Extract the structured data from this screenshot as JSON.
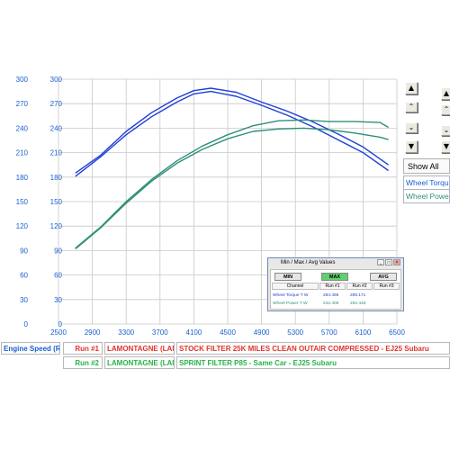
{
  "window": {
    "show_all_label": "Show All",
    "scroll_buttons": [
      "up-double",
      "up",
      "down",
      "down-double"
    ]
  },
  "axes": {
    "left_outer_ticks": [
      "300",
      "270",
      "240",
      "210",
      "180",
      "150",
      "120",
      "90",
      "60",
      "30",
      "0"
    ],
    "left_inner_ticks": [
      "300",
      "270",
      "240",
      "210",
      "180",
      "150",
      "120",
      "90",
      "60",
      "30",
      "0"
    ],
    "x_ticks": [
      "2500",
      "2900",
      "3300",
      "3700",
      "4100",
      "4500",
      "4900",
      "5300",
      "5700",
      "6100",
      "6500"
    ],
    "x_channel_label": "Engine Speed (RI"
  },
  "channels": {
    "wheel_torque": "Wheel Torque",
    "wheel_power": "Wheel Power"
  },
  "runs": [
    {
      "run_label": "Run #1",
      "vehicle": "LAMONTAGNE (LAMO",
      "description": "STOCK FILTER 25K MILES CLEAN OUTAIR COMPRESSED - EJ25 Subaru",
      "color": "#e0322c"
    },
    {
      "run_label": "Run #2",
      "vehicle": "LAMONTAGNE (LAMO",
      "description": "SPRINT FILTER P85 - Same Car - EJ25 Subaru",
      "color": "#23b446"
    }
  ],
  "minmax_window": {
    "title": "Min / Max / Avg Values",
    "buttons": {
      "min": "MIN",
      "max": "MAX",
      "avg": "AVG"
    },
    "columns": [
      "Channel",
      "Run #1",
      "Run #2",
      "Run #3"
    ],
    "rows": [
      {
        "channel": "Wheel Torque T W",
        "run1": "284.495",
        "run2": "289.171",
        "run3": ""
      },
      {
        "channel": "Wheel Power T W",
        "run1": "242.406",
        "run2": "252.446",
        "run3": ""
      }
    ]
  },
  "colors": {
    "torque": "#1f3fd6",
    "power": "#2e8f7a",
    "axis_label": "#1a5fd0",
    "grid": "#c8c8c8"
  },
  "chart_data": {
    "type": "line",
    "x_range": [
      2500,
      6500
    ],
    "y_range": [
      0,
      300
    ],
    "grid": true,
    "series": [
      {
        "name": "Wheel Torque",
        "run": "Run #1",
        "x": [
          2700,
          3000,
          3300,
          3600,
          3900,
          4100,
          4300,
          4600,
          4900,
          5200,
          5500,
          5800,
          6100,
          6400
        ],
        "y": [
          181,
          205,
          232,
          254,
          272,
          282,
          285,
          279,
          268,
          256,
          242,
          226,
          210,
          188
        ]
      },
      {
        "name": "Wheel Torque",
        "run": "Run #2",
        "x": [
          2700,
          3000,
          3300,
          3600,
          3900,
          4100,
          4300,
          4600,
          4900,
          5200,
          5500,
          5800,
          6100,
          6400
        ],
        "y": [
          185,
          207,
          236,
          259,
          277,
          286,
          289,
          284,
          272,
          261,
          248,
          233,
          217,
          195
        ]
      },
      {
        "name": "Wheel Power",
        "run": "Run #1",
        "x": [
          2700,
          3000,
          3300,
          3600,
          3900,
          4200,
          4500,
          4800,
          5100,
          5400,
          5700,
          6000,
          6300,
          6400
        ],
        "y": [
          92,
          118,
          148,
          175,
          197,
          214,
          227,
          236,
          239,
          240,
          238,
          234,
          229,
          226
        ]
      },
      {
        "name": "Wheel Power",
        "run": "Run #2",
        "x": [
          2700,
          3000,
          3300,
          3600,
          3900,
          4200,
          4500,
          4800,
          5100,
          5400,
          5700,
          6000,
          6300,
          6400
        ],
        "y": [
          93,
          119,
          150,
          177,
          200,
          218,
          232,
          243,
          249,
          250,
          248,
          248,
          247,
          241
        ]
      }
    ]
  }
}
